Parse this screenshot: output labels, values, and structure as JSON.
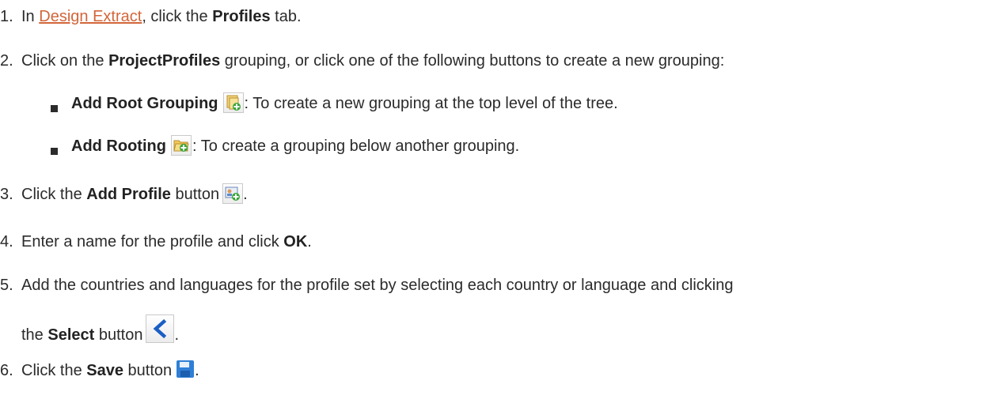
{
  "steps": [
    {
      "num": "1.",
      "pre": "In ",
      "link": "Design Extract",
      "mid": ", click the ",
      "bold": "Profiles",
      "post": " tab."
    },
    {
      "num": "2.",
      "pre": "Click on the ",
      "bold": "ProjectProfiles",
      "post": " grouping, or click one of the following buttons to create a new grouping:"
    },
    {
      "num": "3.",
      "pre": "Click the ",
      "bold": "Add Profile",
      "post": " button",
      "tail": "."
    },
    {
      "num": "4.",
      "pre": "Enter a name for the profile and click ",
      "bold": "OK",
      "post": "."
    },
    {
      "num": "5.",
      "line1": "Add the countries and languages for the profile set by selecting each country or language and clicking",
      "pre": "the ",
      "bold": "Select",
      "post": " button",
      "tail": "."
    },
    {
      "num": "6.",
      "pre": "Click the ",
      "bold": "Save",
      "post": " button",
      "tail": "."
    }
  ],
  "bullets": [
    {
      "bold": "Add Root Grouping",
      "post": ": To create a new grouping at the top level of the tree."
    },
    {
      "bold": "Add Rooting",
      "post": ": To create a grouping below another grouping."
    }
  ],
  "icons": {
    "add_root_grouping": "add-root-grouping-icon",
    "add_rooting": "add-grouping-icon",
    "add_profile": "add-profile-icon",
    "select": "select-left-arrow-icon",
    "save": "save-icon"
  },
  "colors": {
    "link": "#d2663a",
    "text": "#2b2b2b",
    "select_arrow": "#1a5fc4",
    "save_blue": "#2f7fd6",
    "plus_green": "#3aa53a"
  }
}
